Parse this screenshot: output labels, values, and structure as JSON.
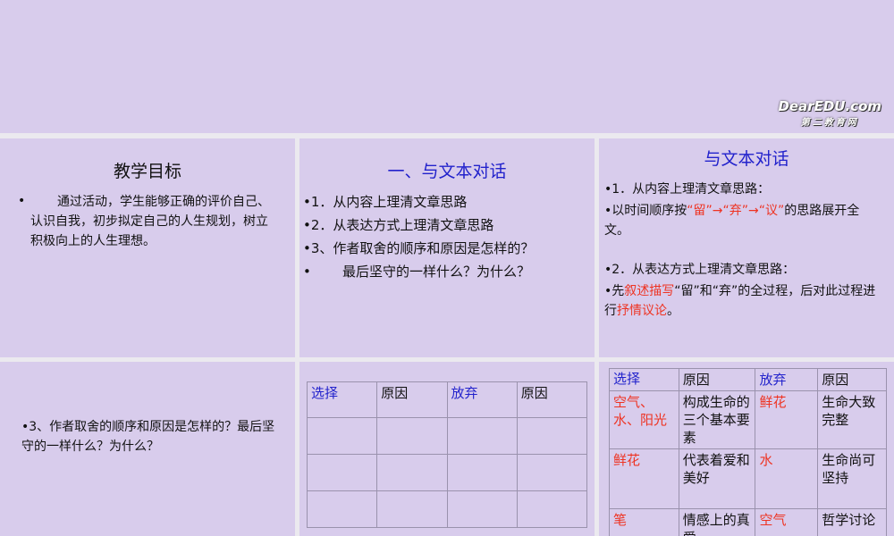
{
  "logo": {
    "main": "DearEDU.com",
    "sub": "第二教育网"
  },
  "slide2": {
    "title": "教学目标",
    "bullet": "•",
    "text": "通过活动，学生能够正确的评价自己、认识自我，初步拟定自己的人生规划，树立积极向上的人生理想。"
  },
  "slide3": {
    "title": "一、与文本对话",
    "items": [
      "•1．从内容上理清文章思路",
      "•2．从表达方式上理清文章思路",
      "•3、作者取舍的顺序和原因是怎样的？",
      "最后坚守的一样什么？为什么？"
    ]
  },
  "slide4": {
    "title": "与文本对话",
    "item1": "•1．从内容上理清文章思路：",
    "item2a": "•以时间顺序按",
    "item2b": "“留”→“弃”→“议”",
    "item2c": "的思路展开全文。",
    "item3": "•2．从表达方式上理清文章思路：",
    "item4a": "•先",
    "item4b": "叙述描写",
    "item4c": "“留”和“弃”的全过程，后对此过程进行",
    "item4d": "抒情议论",
    "item4e": "。"
  },
  "slide5": {
    "text": "•3、作者取舍的顺序和原因是怎样的？最后坚守的一样什么？为什么？"
  },
  "slide6": {
    "headers": [
      "选择",
      "原因",
      "放弃",
      "原因"
    ]
  },
  "slide7": {
    "headers": [
      "选择",
      "原因",
      "放弃",
      "原因"
    ],
    "rows": [
      [
        "空气、水、阳光",
        "构成生命的三个基本要素",
        "鲜花",
        "生命大致完整"
      ],
      [
        "鲜花",
        "代表着爱和美好",
        "水",
        "生命尚可坚持"
      ],
      [
        "笔",
        "情感上的真爱",
        "空气",
        "哲学讨论"
      ]
    ]
  },
  "colors": {
    "slide_bg": "#d8ccec",
    "blue": "#2222cc",
    "red": "#ee3322"
  }
}
